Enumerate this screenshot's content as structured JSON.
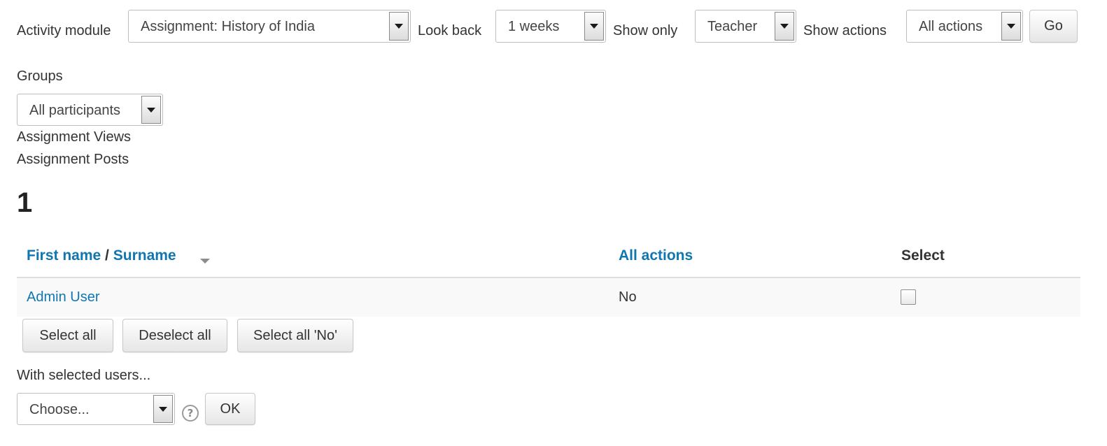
{
  "filters": {
    "activity_module_label": "Activity module",
    "activity_module_value": "Assignment: History of India",
    "look_back_label": "Look back",
    "look_back_value": "1 weeks",
    "show_only_label": "Show only",
    "show_only_value": "Teacher",
    "show_actions_label": "Show actions",
    "show_actions_value": "All actions",
    "go_label": "Go",
    "groups_label": "Groups",
    "groups_value": "All participants"
  },
  "stats_links": {
    "views": "Assignment Views",
    "posts": "Assignment Posts"
  },
  "result_count": "1",
  "table": {
    "header": {
      "first_name": "First name",
      "separator": "/",
      "surname": "Surname",
      "actions": "All actions",
      "select": "Select"
    },
    "rows": [
      {
        "name": "Admin User",
        "actions": "No",
        "selected": false
      }
    ]
  },
  "bulk": {
    "select_all": "Select all",
    "deselect_all": "Deselect all",
    "select_all_no": "Select all 'No'",
    "with_selected_label": "With selected users...",
    "choose_value": "Choose...",
    "ok_label": "OK"
  },
  "icons": {
    "dropdown": "chevron-down-icon",
    "sort": "sort-desc-icon",
    "help": "help-icon"
  },
  "colors": {
    "link": "#0f76b2",
    "text": "#333333",
    "row_background": "#f9f9f9"
  }
}
